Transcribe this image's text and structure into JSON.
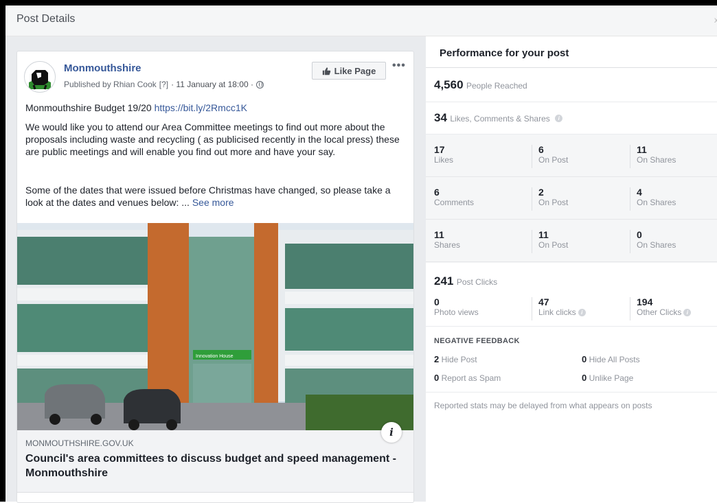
{
  "modal": {
    "title": "Post Details",
    "close_label": "x"
  },
  "post": {
    "page_name": "Monmouthshire",
    "published_by": "Published by Rhian Cook",
    "help_marker": "[?]",
    "timestamp": "· 11 January at 18:00 ·",
    "like_page_label": "Like Page",
    "more_label": "•••",
    "line1_text": "Monmouthshire Budget 19/20 ",
    "line1_link": "https://bit.ly/2Rmcc1K",
    "paragraph1": "We would like you to attend our Area Committee meetings to find out more about the proposals including waste and recycling ( as publicised recently in the local press) these are public meetings and will enable you find out more and have your say.",
    "paragraph2": "Some of the dates that were issued before Christmas have changed, so please take a look at the dates and venues below: ... ",
    "see_more": "See more",
    "link_domain": "MONMOUTHSHIRE.GOV.UK",
    "link_title": "Council's area committees to discuss budget and speed management - Monmouthshire",
    "building_sign": "Innovation House"
  },
  "performance": {
    "title": "Performance for your post",
    "reached": {
      "value": "4,560",
      "label": "People Reached"
    },
    "engagement": {
      "value": "34",
      "label": "Likes, Comments & Shares"
    },
    "rows": [
      [
        {
          "num": "17",
          "label": "Likes"
        },
        {
          "num": "6",
          "label": "On Post"
        },
        {
          "num": "11",
          "label": "On Shares"
        }
      ],
      [
        {
          "num": "6",
          "label": "Comments"
        },
        {
          "num": "2",
          "label": "On Post"
        },
        {
          "num": "4",
          "label": "On Shares"
        }
      ],
      [
        {
          "num": "11",
          "label": "Shares"
        },
        {
          "num": "11",
          "label": "On Post"
        },
        {
          "num": "0",
          "label": "On Shares"
        }
      ]
    ],
    "clicks": {
      "value": "241",
      "label": "Post Clicks"
    },
    "click_breakdown": [
      {
        "num": "0",
        "label": "Photo views"
      },
      {
        "num": "47",
        "label": "Link clicks"
      },
      {
        "num": "194",
        "label": "Other Clicks"
      }
    ],
    "negative": {
      "title": "NEGATIVE FEEDBACK",
      "hide_post": {
        "num": "2",
        "label": "Hide Post"
      },
      "hide_all": {
        "num": "0",
        "label": "Hide All Posts"
      },
      "report_spam": {
        "num": "0",
        "label": "Report as Spam"
      },
      "unlike": {
        "num": "0",
        "label": "Unlike Page"
      }
    },
    "footnote": "Reported stats may be delayed from what appears on posts"
  }
}
